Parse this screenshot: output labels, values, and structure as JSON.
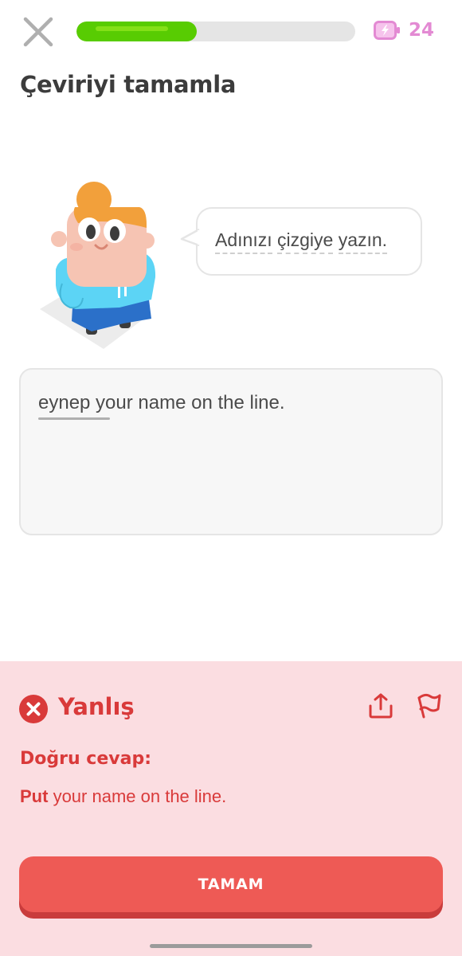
{
  "header": {
    "progress_fraction": 0.43,
    "energy_count": "24"
  },
  "title": "Çeviriyi tamamla",
  "prompt": {
    "words": [
      "Adınızı",
      "çizgiye",
      "yazın."
    ]
  },
  "answer": {
    "typed_text": "eynep your name on the line."
  },
  "feedback": {
    "status": "Yanlış",
    "correct_label": "Doğru cevap:",
    "correct_first_word": "Put",
    "correct_rest": " your name on the line.",
    "button_label": "TAMAM"
  },
  "colors": {
    "progress": "#58cc02",
    "energy": "#e38ad3",
    "error": "#d93a3a",
    "feedback_bg": "#fbdde1",
    "button": "#ee5a55"
  }
}
